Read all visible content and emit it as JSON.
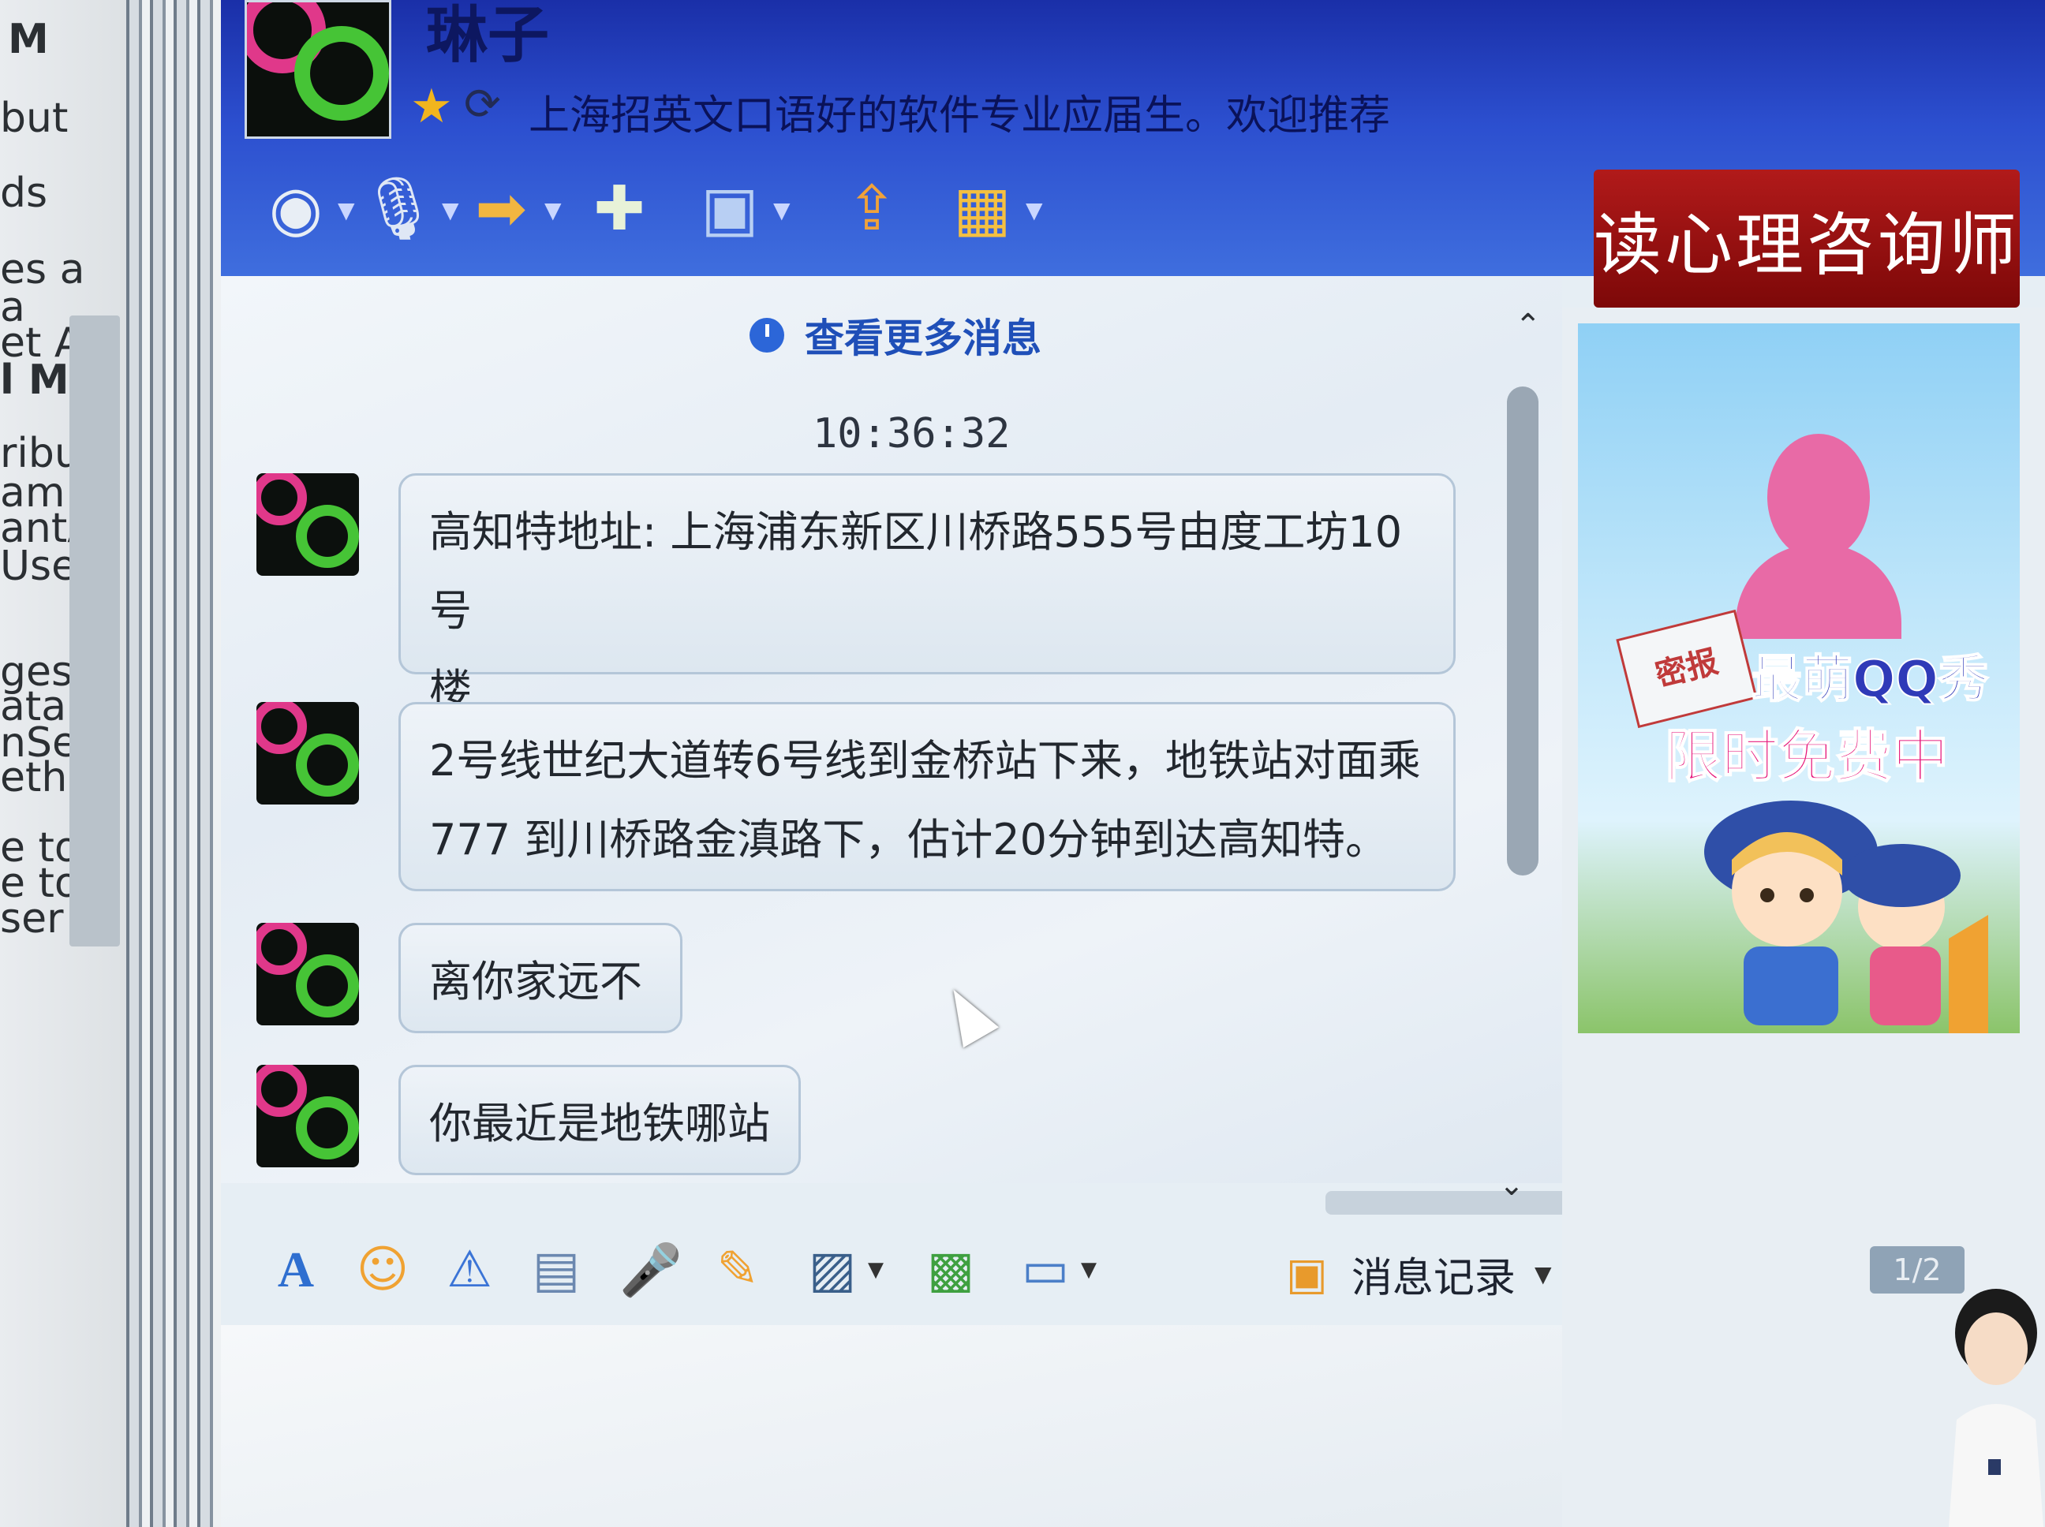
{
  "background_window": {
    "fragments": [
      "M",
      "but",
      "ds",
      "es a",
      "a",
      "et A",
      "l M",
      "ribut",
      "am",
      "antA",
      "User",
      "ges",
      "ata",
      "nSet",
      "etho",
      "e to",
      "e to",
      "ser h"
    ]
  },
  "chat": {
    "contact_name": "琳子",
    "signature": "上海招英文口语好的软件专业应届生。欢迎推荐",
    "more_messages_label": "查看更多消息",
    "timestamp": "10:36:32",
    "messages": [
      {
        "line1": "高知特地址: 上海浦东新区川桥路555号由度工坊10号",
        "line2": "楼"
      },
      {
        "line1": "2号线世纪大道转6号线到金桥站下来，地铁站对面乘",
        "line2": "777 到川桥路金滇路下，估计20分钟到达高知特。"
      },
      {
        "line1": "离你家远不",
        "line2": ""
      },
      {
        "line1": "你最近是地铁哪站",
        "line2": ""
      }
    ],
    "history_label": "消息记录"
  },
  "sidebar": {
    "ad_banner": "读心理咨询师",
    "envelope_text": "密报",
    "promo_line1": "最萌QQ秀",
    "promo_line2": "限时免费中",
    "pager": "1/2"
  },
  "toolbar_icons": [
    "video-call-icon",
    "voice-call-icon",
    "send-file-icon",
    "create-discussion-icon",
    "remote-assist-icon",
    "share-screen-icon",
    "apps-icon"
  ],
  "input_toolbar_icons": [
    "font-icon",
    "emoji-icon",
    "nudge-icon",
    "music-icon",
    "voice-message-icon",
    "doodle-icon",
    "image-icon",
    "sticker-icon",
    "screenshot-icon"
  ],
  "colors": {
    "header_top": "#1a2fa8",
    "header_bottom": "#3f6ede",
    "link_blue": "#1f4fb8",
    "ad_red": "#b11a1a",
    "promo_pink": "#e6157a"
  }
}
